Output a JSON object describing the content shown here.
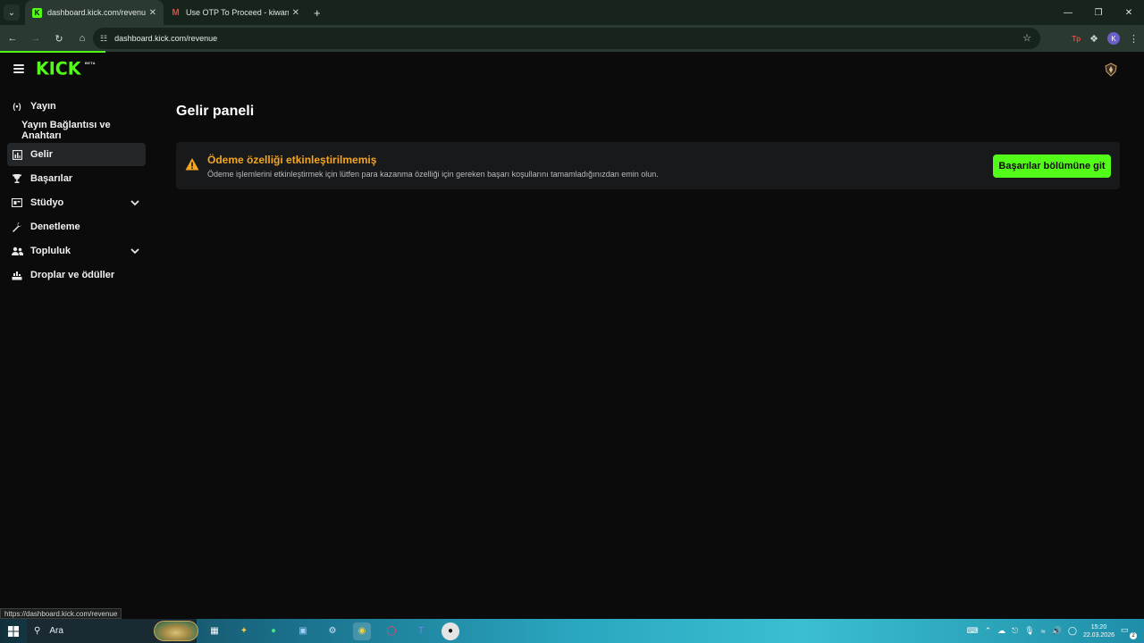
{
  "browser": {
    "tabs": [
      {
        "title": "dashboard.kick.com/revenue",
        "active": true,
        "favicon": "kick-icon"
      },
      {
        "title": "Use OTP To Proceed - kiwancay",
        "active": false,
        "favicon": "gmail-icon"
      }
    ],
    "url": "dashboard.kick.com/revenue",
    "profile_initial": "K",
    "extension_badge": "Tp",
    "status_url": "https://dashboard.kick.com/revenue"
  },
  "app": {
    "logo_text": "KICK",
    "logo_badge": "BETA",
    "brand_color": "#53fc18",
    "sidebar": [
      {
        "label": "Yayın",
        "icon": "broadcast-icon",
        "active": false,
        "chevron": false,
        "sub": false
      },
      {
        "label": "Yayın Bağlantısı ve Anahtarı",
        "icon": "",
        "active": false,
        "chevron": false,
        "sub": true
      },
      {
        "label": "Gelir",
        "icon": "revenue-chart-icon",
        "active": true,
        "chevron": false,
        "sub": false
      },
      {
        "label": "Başarılar",
        "icon": "trophy-icon",
        "active": false,
        "chevron": false,
        "sub": false
      },
      {
        "label": "Stüdyo",
        "icon": "studio-icon",
        "active": false,
        "chevron": true,
        "sub": false
      },
      {
        "label": "Denetleme",
        "icon": "wrench-icon",
        "active": false,
        "chevron": false,
        "sub": false
      },
      {
        "label": "Topluluk",
        "icon": "community-icon",
        "active": false,
        "chevron": true,
        "sub": false
      },
      {
        "label": "Droplar ve ödüller",
        "icon": "drops-icon",
        "active": false,
        "chevron": false,
        "sub": false
      }
    ],
    "page_title": "Gelir paneli",
    "alert": {
      "title": "Ödeme özelliği etkinleştirilmemiş",
      "description": "Ödeme işlemlerini etkinleştirmek için lütfen para kazanma özelliği için gereken başarı koşullarını tamamladığınızdan emin olun.",
      "button": "Başarılar bölümüne git",
      "warning_color": "#f5a623"
    }
  },
  "taskbar": {
    "search_placeholder": "Ara",
    "time": "15:20",
    "date": "22.03.2026",
    "notification_count": "2"
  }
}
